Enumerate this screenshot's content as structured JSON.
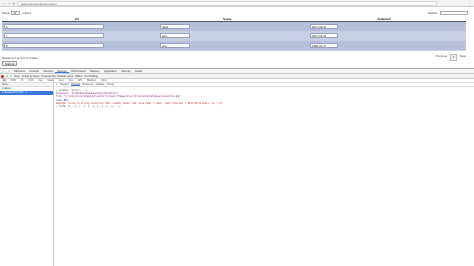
{
  "browser": {
    "url": "www.laravelcrudtest/crudtest"
  },
  "page": {
    "show_label": "Show",
    "show_value": "10",
    "entries_label": "entries",
    "search_label": "Search:",
    "columns": [
      "ID",
      "Name",
      "Inducted"
    ],
    "rows": [
      {
        "id": "6",
        "name": "dana",
        "inducted": "2017-09-14"
      },
      {
        "id": "7",
        "name": "john",
        "inducted": "2017-03-24"
      },
      {
        "id": "8",
        "name": "john",
        "inducted": "1980-01-27"
      }
    ],
    "info": "Showing 1 to 3 of 3 entries",
    "submit_label": "Submit",
    "pager": {
      "previous": "Previous",
      "page": "1",
      "next": "Next"
    }
  },
  "devtools": {
    "tabs": [
      "Elements",
      "Console",
      "Sources",
      "Network",
      "Performance",
      "Memory",
      "Application",
      "Security",
      "Audits"
    ],
    "active_tab": "Network",
    "toolbar": [
      "View:",
      "Group by frame",
      "Preserve log",
      "Disable cache",
      "Offline",
      "No throttling"
    ],
    "filter": [
      "All",
      "XHR",
      "JS",
      "CSS",
      "Img",
      "Media",
      "Font",
      "Doc",
      "WS",
      "Manifest",
      "Other"
    ],
    "req_head": "Name",
    "requests": [
      "crudtest",
      "{\"saveRecord\":{\"ids\":...}"
    ],
    "detail_tabs": [
      "Headers",
      "Preview",
      "Response",
      "Cookies",
      "Timing"
    ],
    "active_detail": "Preview",
    "response": [
      "▾ {status: \"error\", ...}",
      "  exception: \"Illuminate\\Database\\QueryException\"",
      "  file: \"C:\\projects\\crudgentest\\vendor\\laravel\\framework\\src\\Illuminate\\Database\\Connection.php\"",
      "  line: 664",
      "  message: \"Array to string conversion (SQL: update `books` set `book_name` = dana, `date_inducted` = 2017-09-14 where `id` = 6)\"",
      "  ▸ trace: [{...}, {...}, {...}, {...}, {...}, ...]"
    ]
  }
}
